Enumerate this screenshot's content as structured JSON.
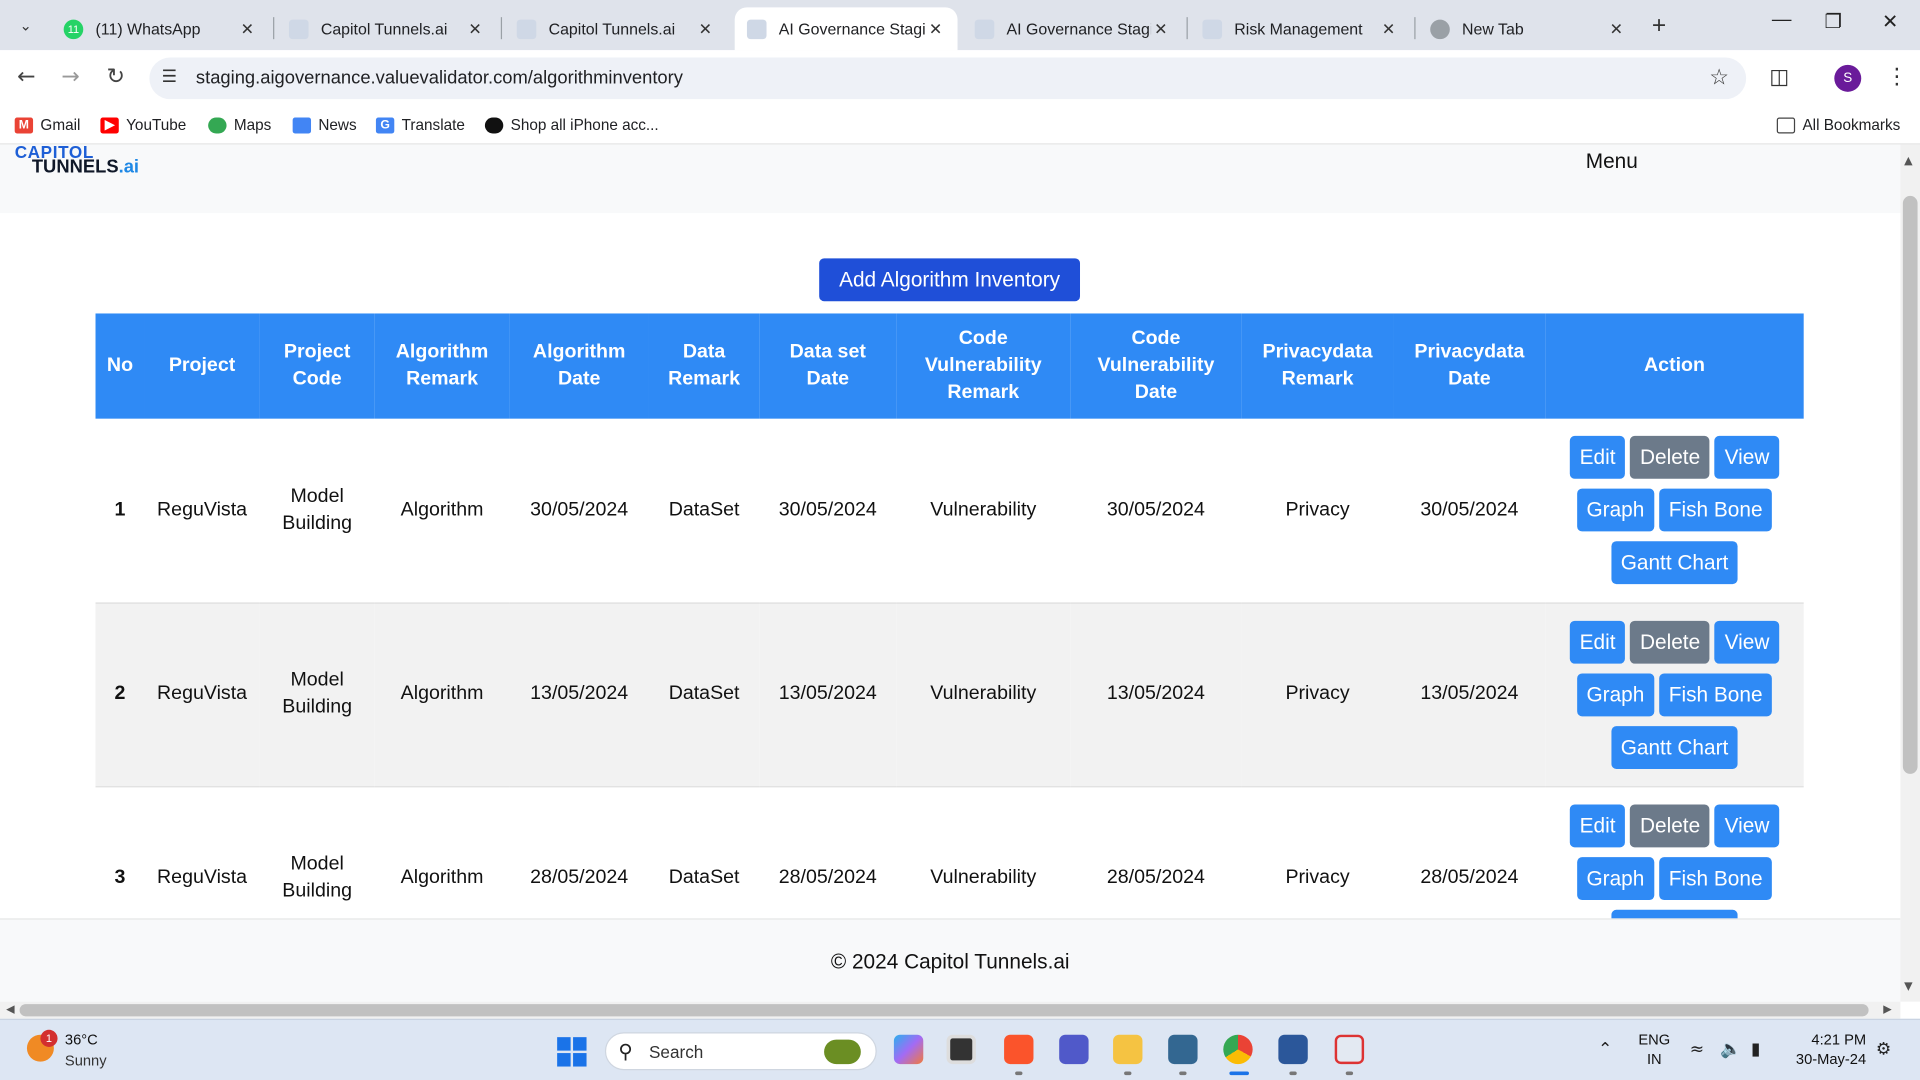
{
  "browser": {
    "tabs": [
      {
        "title": "(11) WhatsApp",
        "badge": "11",
        "active": false
      },
      {
        "title": "Capitol Tunnels.ai",
        "active": false
      },
      {
        "title": "Capitol Tunnels.ai",
        "active": false
      },
      {
        "title": "AI Governance Stagin",
        "active": true
      },
      {
        "title": "AI Governance Stagin",
        "active": false
      },
      {
        "title": "Risk Management",
        "active": false
      },
      {
        "title": "New Tab",
        "active": false
      }
    ],
    "url": "staging.aigovernance.valuevalidator.com/algorithminventory",
    "profile_initial": "S",
    "bookmarks": [
      "Gmail",
      "YouTube",
      "Maps",
      "News",
      "Translate",
      "Shop all iPhone acc..."
    ],
    "all_bookmarks": "All Bookmarks"
  },
  "page": {
    "logo_top": "CAPITOL",
    "logo_main": "TUNNELS",
    "logo_suffix": ".ai",
    "menu_label": "Menu",
    "add_button": "Add Algorithm Inventory",
    "footer": "© 2024 Capitol Tunnels.ai",
    "table": {
      "headers": [
        "No",
        "Project",
        "Project Code",
        "Algorithm Remark",
        "Algorithm Date",
        "Data Remark",
        "Data set Date",
        "Code Vulnerability Remark",
        "Code Vulnerability Date",
        "Privacydata Remark",
        "Privacydata Date",
        "Action"
      ],
      "rows": [
        {
          "no": "1",
          "project": "ReguVista",
          "code": "Model Building",
          "alg_remark": "Algorithm",
          "alg_date": "30/05/2024",
          "data_remark": "DataSet",
          "data_date": "30/05/2024",
          "vuln_remark": "Vulnerability",
          "vuln_date": "30/05/2024",
          "priv_remark": "Privacy",
          "priv_date": "30/05/2024"
        },
        {
          "no": "2",
          "project": "ReguVista",
          "code": "Model Building",
          "alg_remark": "Algorithm",
          "alg_date": "13/05/2024",
          "data_remark": "DataSet",
          "data_date": "13/05/2024",
          "vuln_remark": "Vulnerability",
          "vuln_date": "13/05/2024",
          "priv_remark": "Privacy",
          "priv_date": "13/05/2024"
        },
        {
          "no": "3",
          "project": "ReguVista",
          "code": "Model Building",
          "alg_remark": "Algorithm",
          "alg_date": "28/05/2024",
          "data_remark": "DataSet",
          "data_date": "28/05/2024",
          "vuln_remark": "Vulnerability",
          "vuln_date": "28/05/2024",
          "priv_remark": "Privacy",
          "priv_date": "28/05/2024"
        }
      ],
      "action_labels": {
        "edit": "Edit",
        "delete": "Delete",
        "view": "View",
        "graph": "Graph",
        "fishbone": "Fish Bone",
        "gantt": "Gantt Chart"
      }
    }
  },
  "taskbar": {
    "weather_temp": "36°C",
    "weather_cond": "Sunny",
    "weather_badge": "1",
    "search_label": "Search",
    "lang_1": "ENG",
    "lang_2": "IN",
    "time": "4:21 PM",
    "date": "30-May-24"
  },
  "colors": {
    "table_header": "#2f8af5",
    "primary_button": "#1f4fd8",
    "delete_button": "#6c7a8a"
  }
}
